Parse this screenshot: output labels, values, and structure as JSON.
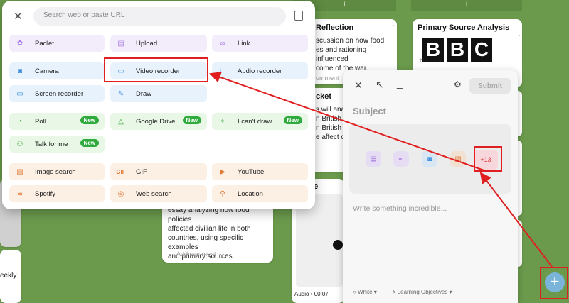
{
  "menu": {
    "search_placeholder": "Search web or paste URL",
    "options": [
      {
        "id": "padlet",
        "label": "Padlet",
        "icon": "padlet-icon",
        "glyph": "✿"
      },
      {
        "id": "upload",
        "label": "Upload",
        "icon": "upload-icon",
        "glyph": "▤"
      },
      {
        "id": "link",
        "label": "Link",
        "icon": "link-icon",
        "glyph": "∞"
      },
      {
        "id": "camera",
        "label": "Camera",
        "icon": "camera-icon",
        "glyph": "◙"
      },
      {
        "id": "video-recorder",
        "label": "Video recorder",
        "icon": "video-icon",
        "glyph": "▭"
      },
      {
        "id": "audio-recorder",
        "label": "Audio recorder",
        "icon": "microphone-icon",
        "glyph": "♩"
      },
      {
        "id": "screen-recorder",
        "label": "Screen recorder",
        "icon": "screen-recorder-icon",
        "glyph": "▭"
      },
      {
        "id": "draw",
        "label": "Draw",
        "icon": "brush-icon",
        "glyph": "✎"
      },
      {
        "id": "poll",
        "label": "Poll",
        "icon": "poll-icon",
        "glyph": "◔",
        "badge": "New"
      },
      {
        "id": "google-drive",
        "label": "Google Drive",
        "icon": "google-drive-icon",
        "glyph": "△",
        "badge": "New"
      },
      {
        "id": "cant-draw",
        "label": "I can't draw",
        "icon": "sparkle-icon",
        "glyph": "✧",
        "badge": "New"
      },
      {
        "id": "talk-for-me",
        "label": "Talk for me",
        "icon": "talk-icon",
        "glyph": "⚇",
        "badge": "New"
      },
      {
        "id": "image-search",
        "label": "Image search",
        "icon": "image-search-icon",
        "glyph": "▧"
      },
      {
        "id": "gif",
        "label": "GIF",
        "icon": "gif-icon",
        "glyph": "GIF"
      },
      {
        "id": "youtube",
        "label": "YouTube",
        "icon": "youtube-icon",
        "glyph": "▶"
      },
      {
        "id": "spotify",
        "label": "Spotify",
        "icon": "spotify-icon",
        "glyph": "≋"
      },
      {
        "id": "web-search",
        "label": "Web search",
        "icon": "globe-icon",
        "glyph": "◎"
      },
      {
        "id": "location",
        "label": "Location",
        "icon": "location-icon",
        "glyph": "⚲"
      }
    ]
  },
  "composer": {
    "subject_placeholder": "Subject",
    "body_placeholder": "Write something incredible...",
    "submit_label": "Submit",
    "more_label": "+13",
    "color_label": "White",
    "section_label": "Learning Objectives"
  },
  "board": {
    "card_reflection_title": "Reflection",
    "card_reflection_lines": [
      "scussion on how food",
      "es and rationing influenced",
      "come of the war."
    ],
    "card_reflection_comment": "omment",
    "card_primary_title": "Primary Source Analysis",
    "card_primary_logo": "BBC",
    "card_primary_domain": "bbc.com",
    "card_mid_title": "cket",
    "card_mid_lines": [
      "s will ana",
      "n British a",
      "n British ar",
      "e affect c"
    ],
    "card_essay_lines": [
      "essay analyzing how food policies",
      "affected civilian life in both",
      "countries, using specific examples",
      "and primary sources."
    ],
    "card_essay_comment": "Add comment",
    "card_audio_title": "r me",
    "card_audio_label": "Audio • 00:07",
    "left_text": "eekly"
  }
}
